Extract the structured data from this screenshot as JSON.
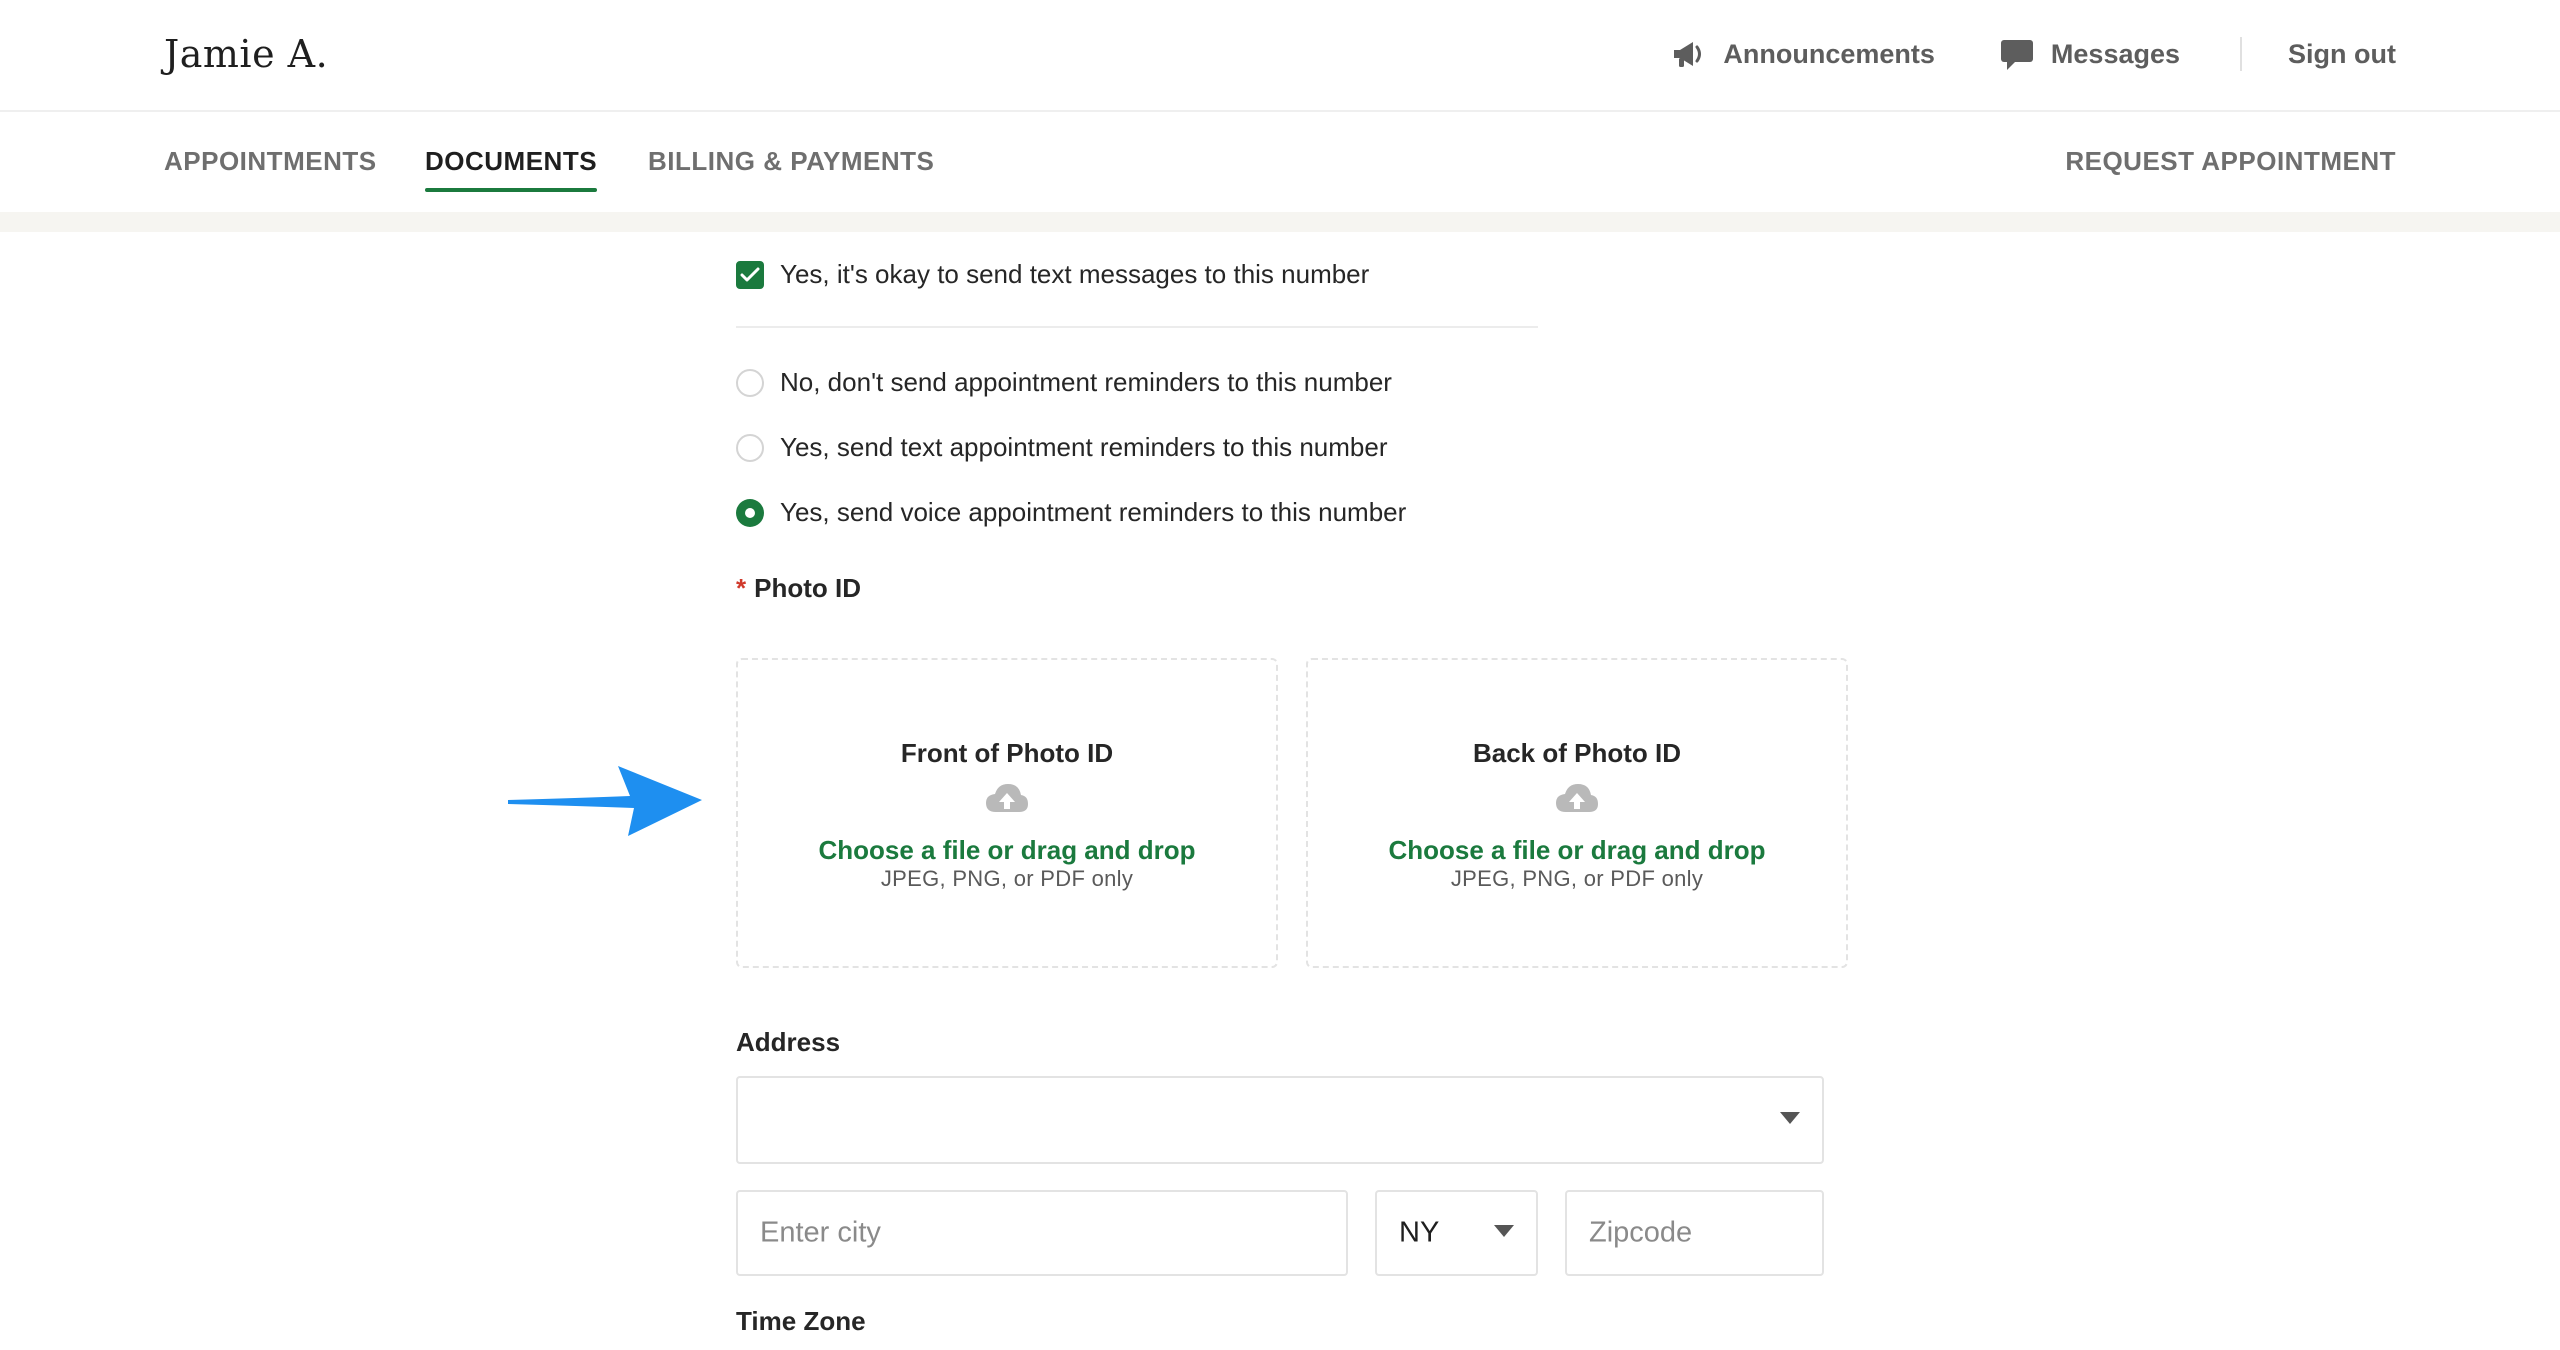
{
  "header": {
    "user_name": "Jamie A.",
    "announcements_label": "Announcements",
    "messages_label": "Messages",
    "signout_label": "Sign out"
  },
  "nav": {
    "tabs": [
      {
        "label": "APPOINTMENTS",
        "active": false
      },
      {
        "label": "DOCUMENTS",
        "active": true
      },
      {
        "label": "BILLING & PAYMENTS",
        "active": false
      }
    ],
    "request_label": "REQUEST APPOINTMENT"
  },
  "form": {
    "text_ok_label": "Yes, it's okay to send text messages to this number",
    "text_ok_checked": true,
    "reminder_options": [
      {
        "label": "No, don't send appointment reminders to this number",
        "selected": false
      },
      {
        "label": "Yes, send text appointment reminders to this number",
        "selected": false
      },
      {
        "label": "Yes, send voice appointment reminders to this number",
        "selected": true
      }
    ],
    "photo_id": {
      "required_mark": "*",
      "label": "Photo ID",
      "front": {
        "title": "Front of Photo ID",
        "link": "Choose a file or drag and drop",
        "hint": "JPEG, PNG, or PDF only"
      },
      "back": {
        "title": "Back of Photo ID",
        "link": "Choose a file or drag and drop",
        "hint": "JPEG, PNG, or PDF only"
      }
    },
    "address": {
      "label": "Address",
      "street_value": "",
      "city_placeholder": "Enter city",
      "state_value": "NY",
      "zip_placeholder": "Zipcode"
    },
    "timezone_label": "Time Zone"
  },
  "colors": {
    "accent_green": "#1b7a3e",
    "required_red": "#d0392b",
    "annotation_arrow": "#1e8ff0"
  }
}
